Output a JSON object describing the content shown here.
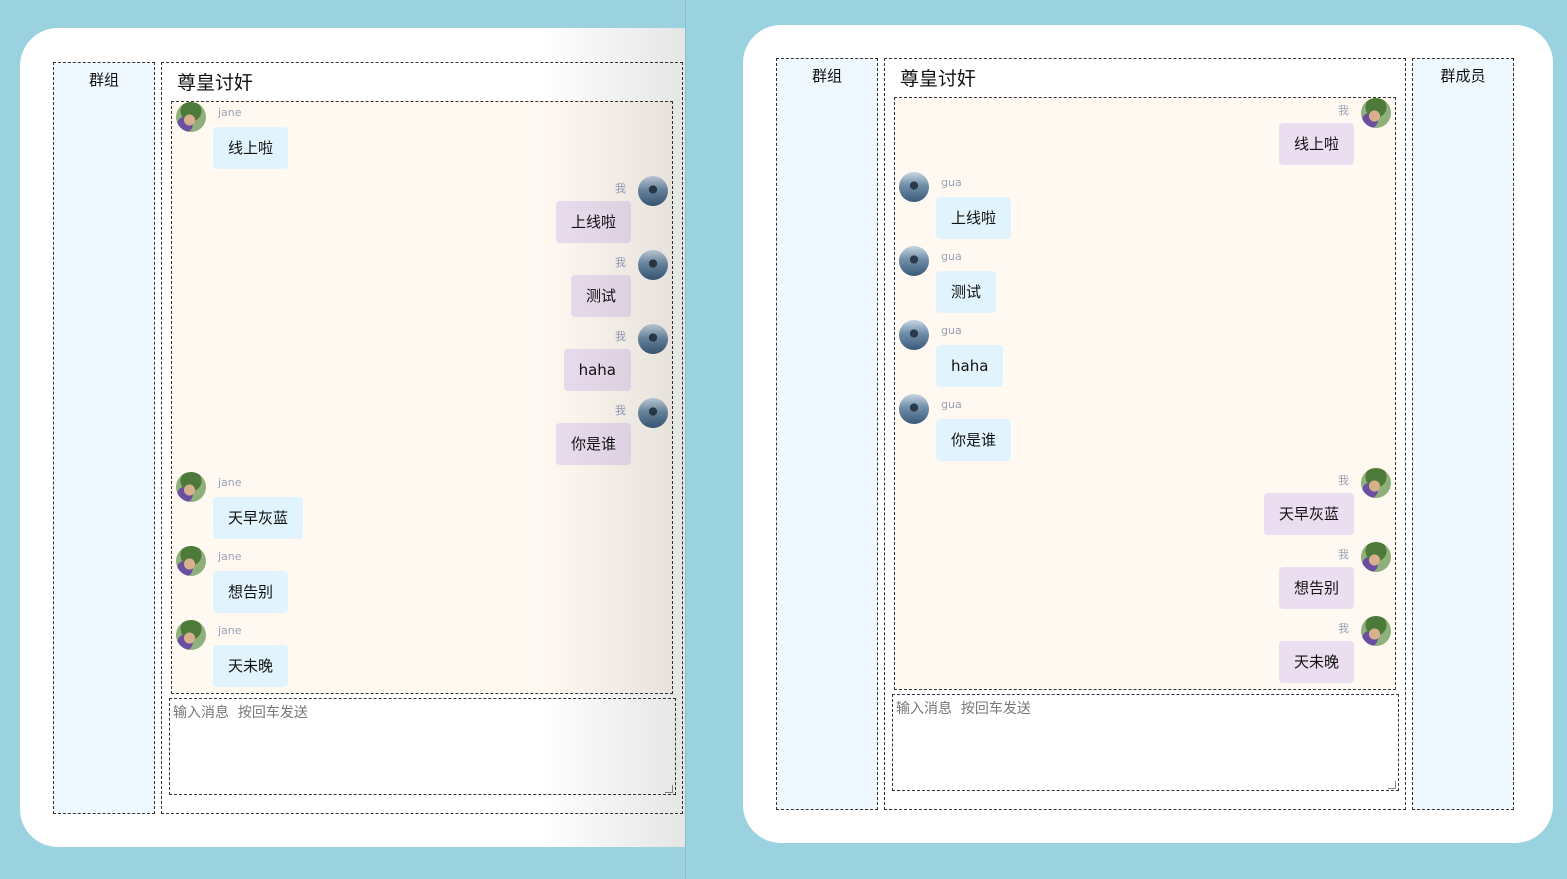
{
  "left_window": {
    "sidebar_title": "群组",
    "room_title": "尊皇讨奸",
    "input_placeholder": "输入消息  按回车发送",
    "messages": [
      {
        "side": "left",
        "sender": "jane",
        "avatar": "jane-avatar",
        "text": "线上啦"
      },
      {
        "side": "right",
        "sender": "我",
        "avatar": "gua-avatar",
        "text": "上线啦"
      },
      {
        "side": "right",
        "sender": "我",
        "avatar": "gua-avatar",
        "text": "测试"
      },
      {
        "side": "right",
        "sender": "我",
        "avatar": "gua-avatar",
        "text": "haha"
      },
      {
        "side": "right",
        "sender": "我",
        "avatar": "gua-avatar",
        "text": "你是谁"
      },
      {
        "side": "left",
        "sender": "jane",
        "avatar": "jane-avatar",
        "text": "天早灰蓝"
      },
      {
        "side": "left",
        "sender": "jane",
        "avatar": "jane-avatar",
        "text": "想告别"
      },
      {
        "side": "left",
        "sender": "jane",
        "avatar": "jane-avatar",
        "text": "天未晚"
      }
    ]
  },
  "right_window": {
    "sidebar_title": "群组",
    "members_title": "群成员",
    "room_title": "尊皇讨奸",
    "input_placeholder": "输入消息  按回车发送",
    "messages": [
      {
        "side": "right",
        "sender": "我",
        "avatar": "jane-avatar",
        "text": "线上啦"
      },
      {
        "side": "left",
        "sender": "gua",
        "avatar": "gua-avatar",
        "text": "上线啦"
      },
      {
        "side": "left",
        "sender": "gua",
        "avatar": "gua-avatar",
        "text": "测试"
      },
      {
        "side": "left",
        "sender": "gua",
        "avatar": "gua-avatar",
        "text": "haha"
      },
      {
        "side": "left",
        "sender": "gua",
        "avatar": "gua-avatar",
        "text": "你是谁"
      },
      {
        "side": "right",
        "sender": "我",
        "avatar": "jane-avatar",
        "text": "天早灰蓝"
      },
      {
        "side": "right",
        "sender": "我",
        "avatar": "jane-avatar",
        "text": "想告别"
      },
      {
        "side": "right",
        "sender": "我",
        "avatar": "jane-avatar",
        "text": "天未晚"
      }
    ]
  },
  "colors": {
    "background": "#9ad3df",
    "sidebar": "#f0f8ff",
    "message_area": "#fff9f2",
    "bubble_other": "#e1f3fc",
    "bubble_self": "#ebdef0",
    "sender_name": "#9a9fb8"
  }
}
